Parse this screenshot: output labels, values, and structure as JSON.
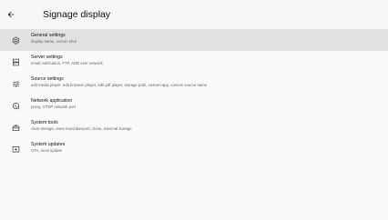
{
  "header": {
    "title": "Signage display"
  },
  "settings": {
    "items": [
      {
        "label": "General settings",
        "sub": "display name, screen shot",
        "icon": "gear-icon",
        "selected": true
      },
      {
        "label": "Server settings",
        "sub": "email notification, FTP, ADB over network",
        "icon": "server-icon",
        "selected": false
      },
      {
        "label": "Source settings",
        "sub": "edit media player, edit browser player, edit pdf player, storage path, custom app, custom source name",
        "icon": "sliders-icon",
        "selected": false
      },
      {
        "label": "Network application",
        "sub": "proxy, OTSP network port",
        "icon": "network-icon",
        "selected": false
      },
      {
        "label": "System tools",
        "sub": "clear storage, reset import&export, clone, external storage",
        "icon": "toolbox-icon",
        "selected": false
      },
      {
        "label": "System updates",
        "sub": "OTA, local update",
        "icon": "system-update-icon",
        "selected": false
      }
    ]
  },
  "colors": {
    "background": "#fafafa",
    "header_background": "#f6f6f6",
    "selected_row": "#e1e1e1",
    "text_primary": "#111111",
    "text_secondary": "#666666"
  }
}
